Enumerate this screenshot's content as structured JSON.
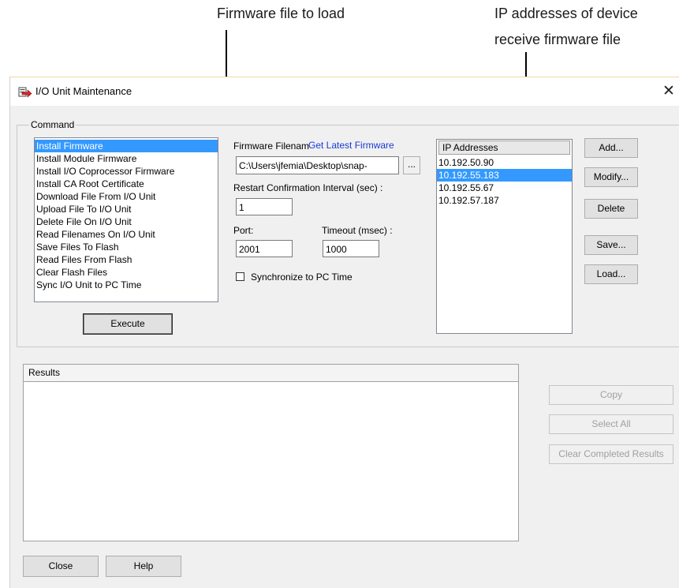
{
  "callouts": {
    "firmware_file": "Firmware file to load",
    "ip_line1": "IP addresses of device",
    "ip_line2": "receive firmware file"
  },
  "window": {
    "title": "I/O Unit Maintenance",
    "close_glyph": "✕",
    "icon": "io-unit-arrow-icon"
  },
  "command": {
    "group_label": "Command",
    "items": [
      {
        "label": "Install Firmware",
        "selected": true
      },
      {
        "label": "Install Module Firmware"
      },
      {
        "label": "Install I/O Coprocessor Firmware"
      },
      {
        "label": "Install CA Root Certificate"
      },
      {
        "label": "Download File From I/O Unit"
      },
      {
        "label": "Upload File To I/O Unit"
      },
      {
        "label": "Delete File On I/O Unit"
      },
      {
        "label": "Read Filenames On I/O Unit"
      },
      {
        "label": "Save Files To Flash"
      },
      {
        "label": "Read Files From Flash"
      },
      {
        "label": "Clear Flash Files"
      },
      {
        "label": "Sync I/O Unit to PC Time"
      }
    ],
    "execute_label": "Execute"
  },
  "params": {
    "firmware_filename_label": "Firmware Filenam",
    "get_latest_link": "Get Latest Firmware",
    "firmware_filename_value": "C:\\Users\\jfemia\\Desktop\\snap-",
    "browse_label": "...",
    "restart_label": "Restart Confirmation Interval (sec) :",
    "restart_value": "1",
    "port_label": "Port:",
    "port_value": "2001",
    "timeout_label": "Timeout (msec) :",
    "timeout_value": "1000",
    "sync_label": "Synchronize to PC Time",
    "sync_checked": false
  },
  "ip": {
    "header": "IP Addresses",
    "items": [
      {
        "label": "10.192.50.90"
      },
      {
        "label": "10.192.55.183",
        "selected": true
      },
      {
        "label": "10.192.55.67"
      },
      {
        "label": "10.192.57.187"
      }
    ],
    "buttons": {
      "add": "Add...",
      "modify": "Modify...",
      "delete": "Delete",
      "save": "Save...",
      "load": "Load..."
    }
  },
  "results": {
    "header": "Results",
    "copy": "Copy",
    "select_all": "Select All",
    "clear_completed": "Clear Completed Results"
  },
  "footer": {
    "close": "Close",
    "help": "Help"
  },
  "colors": {
    "selection": "#3399ff",
    "link": "#1a3ad6",
    "icon_red": "#d9262a"
  }
}
